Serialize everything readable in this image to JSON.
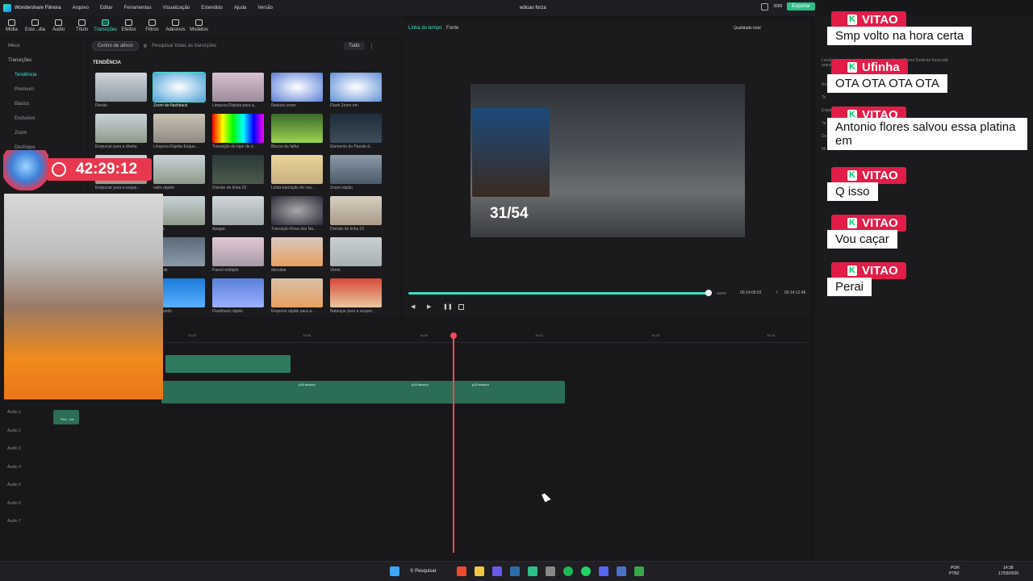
{
  "titlebar": {
    "app": "Wondershare Filmora",
    "menu": [
      "Arquivo",
      "Editar",
      "Ferramentas",
      "Visualização",
      "Estendido",
      "Ajuda",
      "Versão"
    ],
    "document": "edicao forza",
    "credits": "3999",
    "export": "Exportar"
  },
  "tabs": [
    "Mídia",
    "Esto...dia",
    "Áudio",
    "Título",
    "Transições",
    "Efeitos",
    "Filtros",
    "Adesivos",
    "Modelos"
  ],
  "sidebar": {
    "items": [
      "Meus",
      "Transições",
      "Tendência",
      "Premium",
      "Básico",
      "Exclusivo",
      "Zoom",
      "Desfoque"
    ]
  },
  "assets": {
    "center_btn": "Centro de ativos",
    "search_placeholder": "Pesquisar todas as transições",
    "filter": "Tudo",
    "category": "TENDÊNCIA",
    "items": [
      "Flexão",
      "Zoom de flashback",
      "Limpeza Rápida para a...",
      "Reduzir zoom",
      "Flash Zoom em",
      "Empurrar para a direita",
      "Limpeza Rápida Esque...",
      "Transição de bipe de é...",
      "Blocos de falha",
      "Elemento do Pacote d...",
      "Empurrar para a esque...",
      "salto rápido",
      "Divisão de linha 03",
      "Linda transição de ces...",
      "Zoom rápido",
      "rápido",
      "Apagar",
      "Transição Roxa dos Na...",
      "Divisão de linha 02",
      "da lente",
      "Painel múltiplo",
      "derrubar",
      "Vento",
      "ampliando",
      "Flashback rápido",
      "Empurre rápido para a...",
      "Balançar para a esquer..."
    ]
  },
  "player": {
    "timeline_tab": "Linha do tempo",
    "source_tab": "Fonte",
    "quality": "Qualidade total",
    "progress": 0.96,
    "current": "00:14:09:53",
    "total": "00:14:12:46",
    "overlay_counter": "31/54"
  },
  "timeline": {
    "ruler": [
      "14:03",
      "14:06",
      "14:09",
      "14:12",
      "14:15",
      "14:18"
    ],
    "clips": [
      "p18 tecsuro",
      "p18 tecsuro",
      "p18 tecsuro"
    ],
    "audio_clip": "P18_ mix",
    "tracks": [
      "Áudio 1",
      "Áudio 2",
      "Áudio 3",
      "Áudio 4",
      "Áudio 5",
      "Áudio 6",
      "Áudio 7"
    ]
  },
  "stream": {
    "timer": "42:29:12"
  },
  "chat": [
    {
      "user": "VITAO",
      "text": "Smp volto na hora certa"
    },
    {
      "user": "Ufinha",
      "text": "OTA OTA OTA OTA"
    },
    {
      "user": "VITAO",
      "text": "Antonio flores salvou essa platina em"
    },
    {
      "user": "VITAO",
      "text": "Q isso"
    },
    {
      "user": "VITAO",
      "text": "Vou caçar"
    },
    {
      "user": "VITAO",
      "text": "Perai"
    }
  ],
  "rpanel": {
    "path": "...\\Jogos\\Forza 5\\edicao forza.wfp",
    "labels": [
      "Local",
      "arquivo",
      "Re",
      "Te",
      "Espaço",
      "Ta",
      "Du",
      "Mi"
    ]
  },
  "taskbar": {
    "search": "Pesquisar",
    "lang": "POR",
    "lang2": "PTB2",
    "time": "14:38",
    "date": "17/03/2026"
  }
}
